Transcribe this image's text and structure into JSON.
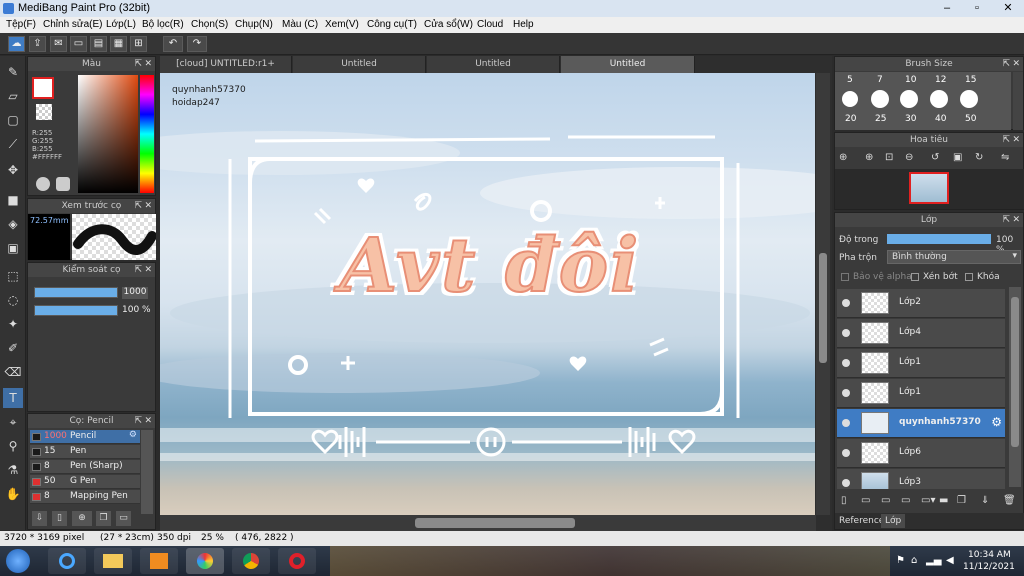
{
  "window": {
    "title": "MediBang Paint Pro (32bit)"
  },
  "menu": [
    "Tệp(F)",
    "Chỉnh sửa(E)",
    "Lớp(L)",
    "Bộ lọc(R)",
    "Chọn(S)",
    "Chụp(N)",
    "Màu (C)",
    "Xem(V)",
    "Công cụ(T)",
    "Cửa sổ(W)",
    "Cloud",
    "Help"
  ],
  "tabs": [
    "[cloud] UNTITLED:r1+",
    "Untitled",
    "Untitled",
    "Untitled"
  ],
  "color_panel": {
    "title": "Màu",
    "r": "R:255",
    "g": "G:255",
    "b": "B:255",
    "hex": "#FFFFFF",
    "primary": "#ffffff",
    "secondary": "#e02020"
  },
  "brush_preview": {
    "title": "Xem trước cọ",
    "size": "72.57mm"
  },
  "brush_control": {
    "title": "Kiểm soát cọ",
    "size_value": "1000",
    "opacity_value": "100 %"
  },
  "brush_list": {
    "title": "Cọ: Pencil",
    "items": [
      {
        "size": "1000",
        "name": "Pencil",
        "color": "#1a1a1a"
      },
      {
        "size": "15",
        "name": "Pen",
        "color": "#1a1a1a"
      },
      {
        "size": "8",
        "name": "Pen (Sharp)",
        "color": "#1a1a1a"
      },
      {
        "size": "50",
        "name": "G Pen",
        "color": "#e03030"
      },
      {
        "size": "8",
        "name": "Mapping Pen",
        "color": "#e03030"
      }
    ]
  },
  "brush_size_panel": {
    "title": "Brush Size",
    "top": [
      "5",
      "7",
      "10",
      "12",
      "15"
    ],
    "bottom": [
      "20",
      "25",
      "30",
      "40",
      "50"
    ]
  },
  "navigator": {
    "title": "Hoa tiêu"
  },
  "layer_panel": {
    "title": "Lớp",
    "opacity_label": "Độ trong",
    "opacity_value": "100 %",
    "blend_label": "Pha trộn",
    "blend_value": "Bình thường",
    "protect_alpha": "Bảo vệ alpha",
    "clipping": "Xén bớt",
    "lock": "Khóa",
    "layers": [
      "Lớp2",
      "Lớp4",
      "Lớp1",
      "Lớp1",
      "quynhanh57370",
      "Lớp6",
      "Lớp3"
    ],
    "selected_index": 4
  },
  "bottom_tabs": [
    "Reference",
    "Lớp"
  ],
  "artwork": {
    "watermark1": "quynhanh57370",
    "watermark2": "hoidap247",
    "headline": "Avt đôi"
  },
  "status": {
    "size": "3720 * 3169 pixel",
    "cm": "(27 * 23cm)",
    "dpi": "350 dpi",
    "zoom": "25 %",
    "coords": "( 476, 2822 )"
  },
  "taskbar": {
    "time": "10:34 AM",
    "date": "11/12/2021"
  }
}
